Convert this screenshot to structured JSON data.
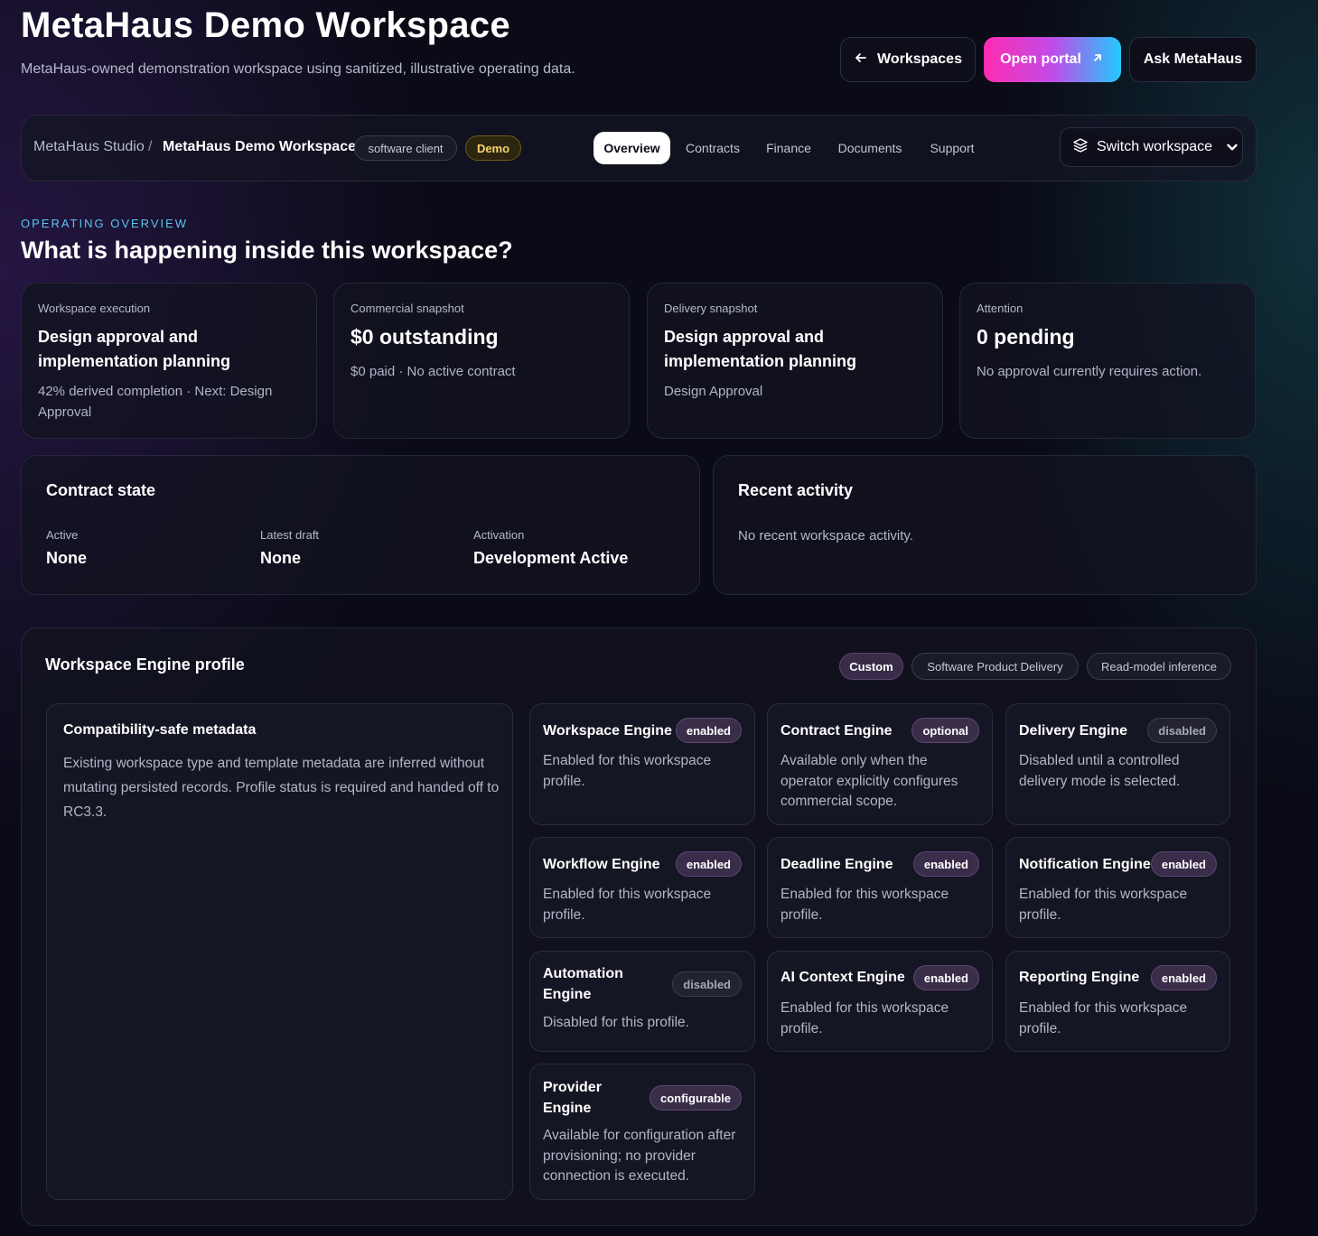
{
  "header": {
    "title": "MetaHaus Demo Workspace",
    "subtitle": "MetaHaus-owned demonstration workspace using sanitized, illustrative operating data.",
    "buttons": {
      "workspaces": "Workspaces",
      "open_portal": "Open portal",
      "ask": "Ask MetaHaus"
    }
  },
  "breadcrumb": {
    "root": "MetaHaus Studio",
    "separator": "/",
    "current": "MetaHaus Demo Workspace",
    "type_pill": "software client",
    "demo_pill": "Demo"
  },
  "tabs": [
    "Overview",
    "Contracts",
    "Finance",
    "Documents",
    "Support"
  ],
  "active_tab": "Overview",
  "switch_workspace": "Switch workspace",
  "overview": {
    "eyebrow": "OPERATING OVERVIEW",
    "title": "What is happening inside this workspace?"
  },
  "stats": [
    {
      "label": "Workspace execution",
      "value": "Design approval and implementation planning",
      "detail": "42% derived completion · Next: Design Approval"
    },
    {
      "label": "Commercial snapshot",
      "value": "$0 outstanding",
      "detail": "$0 paid · No active contract"
    },
    {
      "label": "Delivery snapshot",
      "value": "Design approval and implementation planning",
      "detail": "Design Approval"
    },
    {
      "label": "Attention",
      "value": "0 pending",
      "detail": "No approval currently requires action."
    }
  ],
  "contract_state": {
    "title": "Contract state",
    "fields": [
      {
        "label": "Active",
        "value": "None"
      },
      {
        "label": "Latest draft",
        "value": "None"
      },
      {
        "label": "Activation",
        "value": "Development Active"
      }
    ]
  },
  "recent_activity": {
    "title": "Recent activity",
    "empty": "No recent workspace activity."
  },
  "engine_profile": {
    "title": "Workspace Engine profile",
    "tags": [
      "Custom",
      "Software Product Delivery",
      "Read-model inference"
    ],
    "metadata": {
      "title": "Compatibility-safe metadata",
      "body": "Existing workspace type and template metadata are inferred without mutating persisted records. Profile status is required and handed off to RC3.3."
    },
    "engines": [
      {
        "name": "Workspace Engine",
        "status": "enabled",
        "desc": "Enabled for this workspace profile."
      },
      {
        "name": "Contract Engine",
        "status": "optional",
        "desc": "Available only when the operator explicitly configures commercial scope."
      },
      {
        "name": "Delivery Engine",
        "status": "disabled",
        "desc": "Disabled until a controlled delivery mode is selected."
      },
      {
        "name": "Workflow Engine",
        "status": "enabled",
        "desc": "Enabled for this workspace profile."
      },
      {
        "name": "Deadline Engine",
        "status": "enabled",
        "desc": "Enabled for this workspace profile."
      },
      {
        "name": "Notification Engine",
        "status": "enabled",
        "desc": "Enabled for this workspace profile."
      },
      {
        "name": "Automation Engine",
        "status": "disabled",
        "desc": "Disabled for this profile."
      },
      {
        "name": "AI Context Engine",
        "status": "enabled",
        "desc": "Enabled for this workspace profile."
      },
      {
        "name": "Reporting Engine",
        "status": "enabled",
        "desc": "Enabled for this workspace profile."
      },
      {
        "name": "Provider Engine",
        "status": "configurable",
        "desc": "Available for configuration after provisioning; no provider connection is executed."
      }
    ]
  },
  "colors": {
    "background": "#0a0b16",
    "accent_eyebrow": "#57c6ef",
    "portal_gradient_start": "#ff2bb0",
    "portal_gradient_end": "#22c9ff",
    "demo_badge": "#f6d36b",
    "enabled_badge_bg": "#3a2d49"
  },
  "icons": {
    "workspaces_button": "arrow-left-icon",
    "open_portal_button": "arrow-up-right-icon",
    "switch_workspace": "layers-icon",
    "switch_workspace_caret": "chevron-down-icon"
  }
}
